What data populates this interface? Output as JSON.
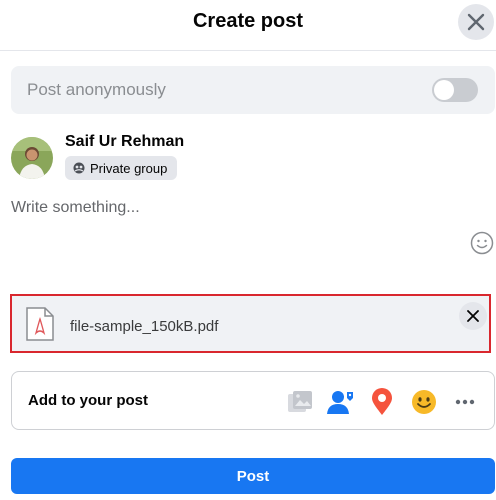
{
  "header": {
    "title": "Create post"
  },
  "anonymous": {
    "label": "Post anonymously",
    "enabled": false
  },
  "user": {
    "name": "Saif Ur Rehman",
    "privacy": "Private group"
  },
  "composer": {
    "placeholder": "Write something..."
  },
  "attachment": {
    "file_name": "file-sample_150kB.pdf"
  },
  "add_to_post": {
    "label": "Add to your post",
    "items": [
      "photo-video-icon",
      "tag-people-icon",
      "location-icon",
      "feeling-icon",
      "more-icon"
    ]
  },
  "actions": {
    "post_label": "Post"
  },
  "colors": {
    "primary": "#1877f2",
    "location": "#f5533d",
    "feeling": "#f7b928",
    "error_border": "#d9272e"
  }
}
